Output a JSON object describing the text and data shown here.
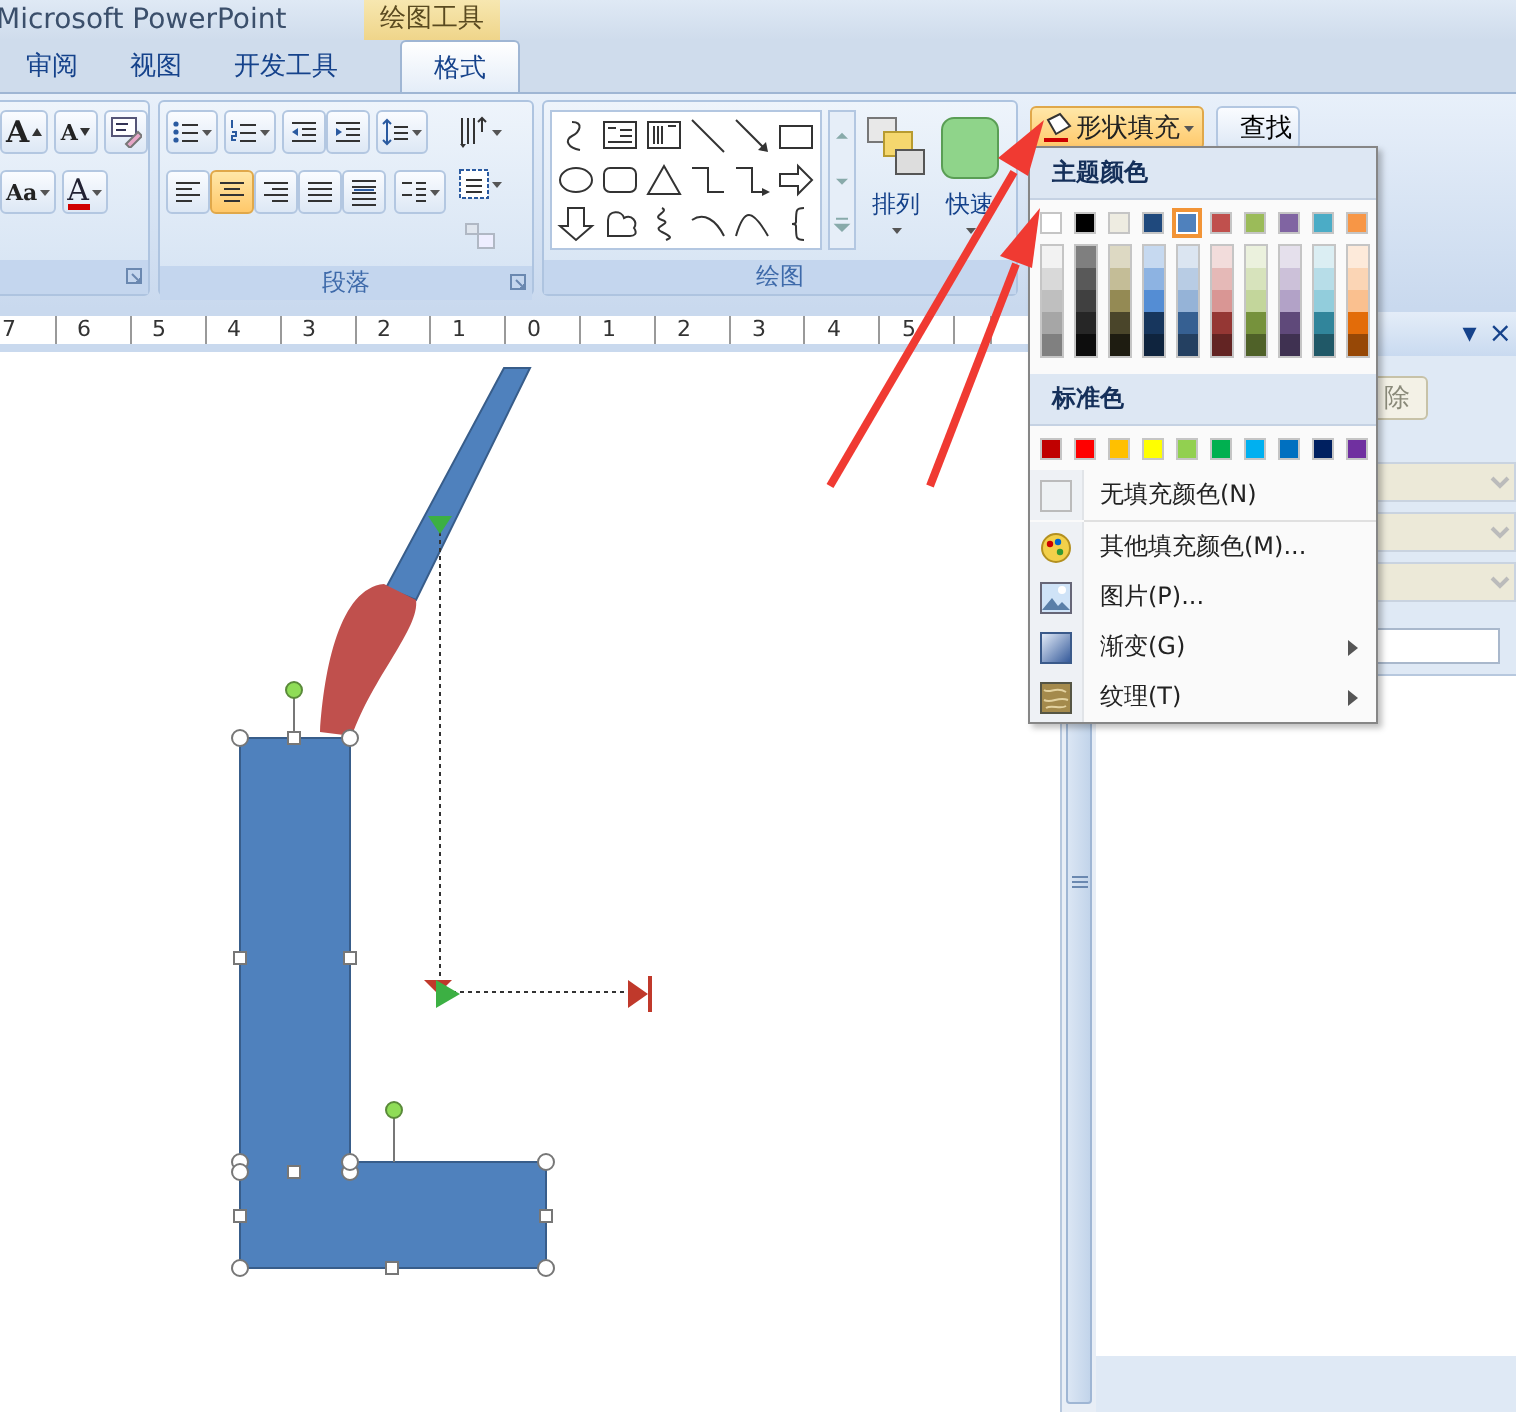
{
  "app_title": "Microsoft PowerPoint",
  "context_tab": "绘图工具",
  "tabs": [
    {
      "label": "审阅",
      "selected": false
    },
    {
      "label": "视图",
      "selected": false
    },
    {
      "label": "开发工具",
      "selected": false
    },
    {
      "label": "格式",
      "selected": true
    }
  ],
  "font_group": {
    "grow": "A",
    "shrink": "A",
    "case": "Aa",
    "font_color": "A"
  },
  "paragraph_group": {
    "label": "段落",
    "alignments": [
      {
        "kind": "left",
        "selected": false
      },
      {
        "kind": "center",
        "selected": true
      },
      {
        "kind": "right",
        "selected": false
      },
      {
        "kind": "justify",
        "selected": false
      },
      {
        "kind": "distribute",
        "selected": false
      }
    ]
  },
  "drawing_group": {
    "label": "绘图",
    "arrange": "排列",
    "quick_styles": "快速"
  },
  "shape_fill_button": "形状填充",
  "find_button": "查找",
  "ruler_labels": [
    "7",
    "6",
    "5",
    "4",
    "3",
    "2",
    "1",
    "0",
    "1",
    "2",
    "3",
    "4",
    "5"
  ],
  "task_pane": {
    "menu_glyph": "▾",
    "close_glyph": "×",
    "delete_button": "除"
  },
  "fill_menu": {
    "theme_heading": "主题颜色",
    "theme_colors": [
      {
        "color": "#ffffff",
        "selected": false,
        "shades": [
          {
            "color": "#f2f2f2"
          },
          {
            "color": "#d9d9d9"
          },
          {
            "color": "#bfbfbf"
          },
          {
            "color": "#a6a6a6"
          },
          {
            "color": "#808080"
          }
        ]
      },
      {
        "color": "#000000",
        "selected": false,
        "shades": [
          {
            "color": "#7f7f7f"
          },
          {
            "color": "#595959"
          },
          {
            "color": "#404040"
          },
          {
            "color": "#262626"
          },
          {
            "color": "#0d0d0d"
          }
        ]
      },
      {
        "color": "#eeece1",
        "selected": false,
        "shades": [
          {
            "color": "#ddd9c3"
          },
          {
            "color": "#c4bd97"
          },
          {
            "color": "#948a54"
          },
          {
            "color": "#4a452a"
          },
          {
            "color": "#1e1c11"
          }
        ]
      },
      {
        "color": "#1f497d",
        "selected": false,
        "shades": [
          {
            "color": "#c6d9f0"
          },
          {
            "color": "#8db3e2"
          },
          {
            "color": "#548dd4"
          },
          {
            "color": "#17365d"
          },
          {
            "color": "#0f243e"
          }
        ]
      },
      {
        "color": "#4f81bd",
        "selected": true,
        "shades": [
          {
            "color": "#dbe5f1"
          },
          {
            "color": "#b8cce4"
          },
          {
            "color": "#95b3d7"
          },
          {
            "color": "#366092"
          },
          {
            "color": "#244061"
          }
        ]
      },
      {
        "color": "#c0504d",
        "selected": false,
        "shades": [
          {
            "color": "#f2dcdb"
          },
          {
            "color": "#e5b9b7"
          },
          {
            "color": "#d99694"
          },
          {
            "color": "#953734"
          },
          {
            "color": "#632423"
          }
        ]
      },
      {
        "color": "#9bbb59",
        "selected": false,
        "shades": [
          {
            "color": "#ebf1dd"
          },
          {
            "color": "#d7e3bc"
          },
          {
            "color": "#c3d69b"
          },
          {
            "color": "#76923c"
          },
          {
            "color": "#4f6128"
          }
        ]
      },
      {
        "color": "#8064a2",
        "selected": false,
        "shades": [
          {
            "color": "#e5e0ec"
          },
          {
            "color": "#ccc1d9"
          },
          {
            "color": "#b2a2c7"
          },
          {
            "color": "#5f497a"
          },
          {
            "color": "#3f3151"
          }
        ]
      },
      {
        "color": "#4bacc6",
        "selected": false,
        "shades": [
          {
            "color": "#dbeef3"
          },
          {
            "color": "#b7dde8"
          },
          {
            "color": "#92cddc"
          },
          {
            "color": "#31859b"
          },
          {
            "color": "#205867"
          }
        ]
      },
      {
        "color": "#f79646",
        "selected": false,
        "shades": [
          {
            "color": "#fdeada"
          },
          {
            "color": "#fbd5b5"
          },
          {
            "color": "#fac08f"
          },
          {
            "color": "#e36c09"
          },
          {
            "color": "#974806"
          }
        ]
      }
    ],
    "standard_heading": "标准色",
    "standard_colors": [
      {
        "color": "#c00000"
      },
      {
        "color": "#ff0000"
      },
      {
        "color": "#ffc000"
      },
      {
        "color": "#ffff00"
      },
      {
        "color": "#92d050"
      },
      {
        "color": "#00b050"
      },
      {
        "color": "#00b0f0"
      },
      {
        "color": "#0070c0"
      },
      {
        "color": "#002060"
      },
      {
        "color": "#7030a0"
      }
    ],
    "items": [
      {
        "kind": "none",
        "label": "无填充颜色(N)",
        "submenu": false
      },
      {
        "kind": "more",
        "label": "其他填充颜色(M)...",
        "submenu": false
      },
      {
        "kind": "picture",
        "label": "图片(P)...",
        "submenu": false
      },
      {
        "kind": "gradient",
        "label": "渐变(G)",
        "submenu": true
      },
      {
        "kind": "texture",
        "label": "纹理(T)",
        "submenu": true
      }
    ]
  }
}
